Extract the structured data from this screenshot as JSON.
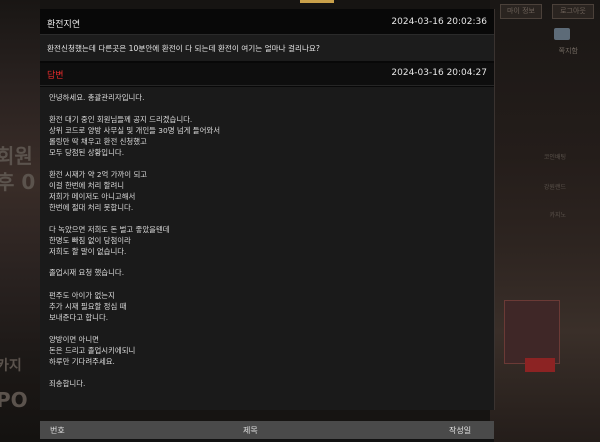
{
  "post": {
    "title": "환전지연",
    "date": "2024-03-16 20:02:36",
    "question": "환전신청했는데 다른곳은 10분안에 환전이 다 되는데 환전이 여기는 얼마나 걸리나요?"
  },
  "reply": {
    "title": "답변",
    "date": "2024-03-16 20:04:27",
    "paragraphs": [
      "안녕하세요. 총괄관리자입니다.",
      "환전 대기 중인 회원님들께 공지 드리겠습니다.",
      "상위 코드로 양방 사무실 및 개인들 30명 넘게 들어와서",
      "롤링만 딱 채우고 환전 신청했고",
      "모두 당첨된 상황입니다.",
      "환전 시재가 약 2억 가까이 되고",
      "이걸 한번에 처리 할려니",
      "저희가 메이저도 아니고해서",
      "한번에 절대 처리 못합니다.",
      "다 녹았으면 저희도 돈 벌고 좋았을텐데",
      "한명도 빠짐 없이 당첨이라",
      "저희도 할 말이 없습니다.",
      "졸업시재 요청 했습니다.",
      "펀주도 아이가 없는지",
      "추가 시재 필요할 정심 때",
      "보내준다고 합니다.",
      "양방이면 아니면",
      "돈은 드리고 졸업시키에되니",
      "하루만 기다려주세요.",
      "죄송합니다."
    ]
  },
  "table": {
    "headers": [
      "번호",
      "제목",
      "작성일"
    ]
  },
  "background": {
    "left_big": [
      "회원",
      "후 0",
      "카지",
      "PO"
    ],
    "right_buttons": [
      "마이 정보",
      "로그아웃"
    ],
    "right_icon_label": "쪽지함",
    "right_texts": [
      "코인배팅",
      "강원랜드",
      "카지노"
    ]
  }
}
